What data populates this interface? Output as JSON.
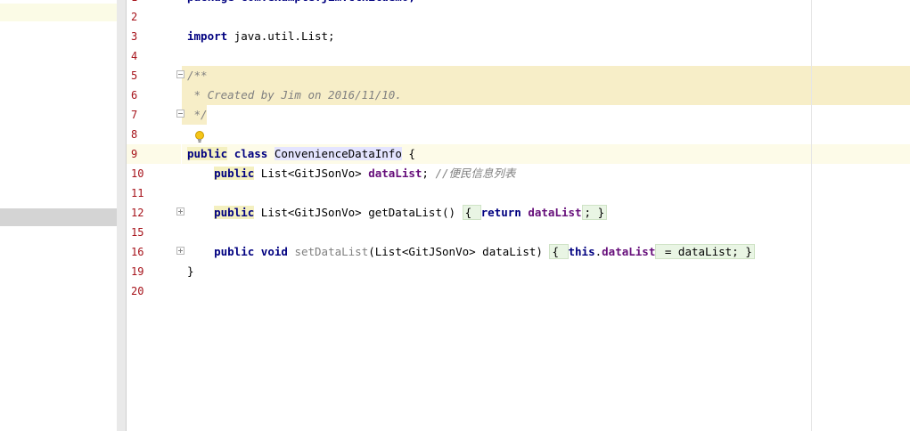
{
  "editor": {
    "lines": [
      {
        "num": "1",
        "tokens": [
          {
            "t": "package com.example.jim.ctkitdemo;",
            "c": "kw"
          }
        ]
      },
      {
        "num": "2",
        "tokens": []
      },
      {
        "num": "3",
        "tokens": [
          {
            "t": "import",
            "c": "kw"
          },
          {
            "t": " java.util.List;",
            "c": ""
          }
        ]
      },
      {
        "num": "4",
        "tokens": []
      },
      {
        "num": "5",
        "tokens": [
          {
            "t": "/**",
            "c": "cmt"
          }
        ]
      },
      {
        "num": "6",
        "tokens": [
          {
            "t": " * Created by Jim on 2016/11/10.",
            "c": "cmt"
          }
        ]
      },
      {
        "num": "7",
        "tokens": [
          {
            "t": " */",
            "c": "cmt"
          }
        ]
      },
      {
        "num": "8",
        "tokens": []
      },
      {
        "num": "9",
        "tokens": [
          {
            "t": "public",
            "c": "kw kw-hl"
          },
          {
            "t": " ",
            "c": ""
          },
          {
            "t": "class",
            "c": "kw"
          },
          {
            "t": " ",
            "c": ""
          },
          {
            "t": "ConvenienceDataInfo",
            "c": "cls-hl"
          },
          {
            "t": " {",
            "c": ""
          }
        ]
      },
      {
        "num": "10",
        "tokens": [
          {
            "t": "    ",
            "c": ""
          },
          {
            "t": "public",
            "c": "kw kw-hl"
          },
          {
            "t": " List<GitJSonVo> ",
            "c": ""
          },
          {
            "t": "dataList",
            "c": "fld"
          },
          {
            "t": "; ",
            "c": ""
          },
          {
            "t": "//便民信息列表",
            "c": "cmt"
          }
        ]
      },
      {
        "num": "11",
        "tokens": []
      },
      {
        "num": "12",
        "tokens": [
          {
            "t": "    ",
            "c": ""
          },
          {
            "t": "public",
            "c": "kw kw-hl"
          },
          {
            "t": " List<GitJSonVo> getDataList() ",
            "c": ""
          },
          {
            "t": "{ ",
            "c": "folded-open"
          },
          {
            "t": "return",
            "c": "kw"
          },
          {
            "t": " ",
            "c": ""
          },
          {
            "t": "dataList",
            "c": "fld"
          },
          {
            "t": "; }",
            "c": "folded-close"
          }
        ]
      },
      {
        "num": "15",
        "tokens": []
      },
      {
        "num": "16",
        "tokens": [
          {
            "t": "    ",
            "c": ""
          },
          {
            "t": "public",
            "c": "kw"
          },
          {
            "t": " ",
            "c": ""
          },
          {
            "t": "void",
            "c": "kw"
          },
          {
            "t": " ",
            "c": ""
          },
          {
            "t": "setDataList",
            "c": "fold"
          },
          {
            "t": "(List<GitJSonVo> dataList) ",
            "c": ""
          },
          {
            "t": "{ ",
            "c": "folded-open"
          },
          {
            "t": "this",
            "c": "kw"
          },
          {
            "t": ".",
            "c": ""
          },
          {
            "t": "dataList",
            "c": "fld"
          },
          {
            "t": " = dataList; }",
            "c": "folded-close"
          }
        ]
      },
      {
        "num": "19",
        "tokens": [
          {
            "t": "}",
            "c": ""
          }
        ]
      },
      {
        "num": "20",
        "tokens": []
      }
    ]
  },
  "icons": {
    "bulb": "lightbulb-icon",
    "fold": "fold-icon",
    "unfold": "unfold-icon"
  },
  "colors": {
    "keyword": "#000080",
    "field": "#660e7a",
    "comment": "#808080",
    "line_number": "#a6121a",
    "comment_highlight": "#f7eec8",
    "caret_row": "#fdfbe8"
  }
}
